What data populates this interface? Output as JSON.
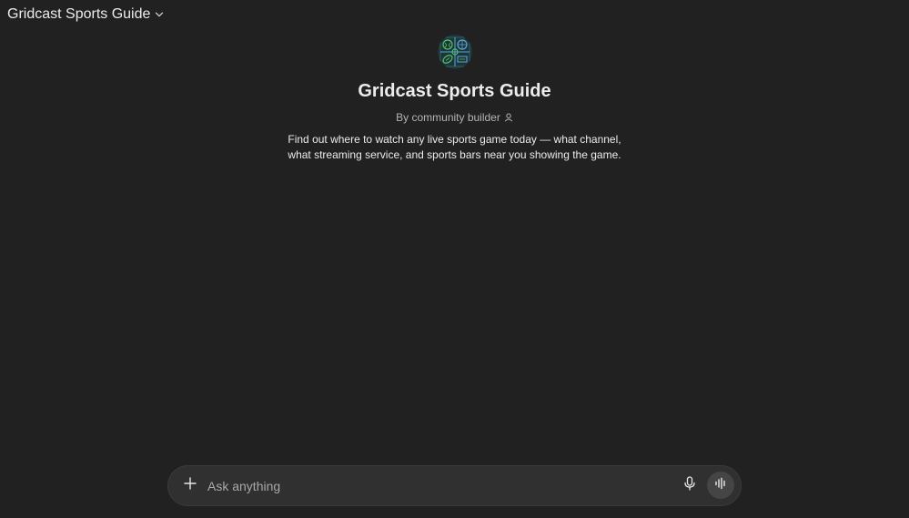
{
  "header": {
    "gpt_selector_label": "Gridcast Sports Guide",
    "chevron_icon": "chevron-down-icon"
  },
  "gpt": {
    "logo_icon": "sports-grid-logo",
    "title": "Gridcast Sports Guide",
    "byline": "By community builder",
    "byline_icon": "person-icon",
    "description": "Find out where to watch any live sports game today — what channel, what streaming service, and sports bars near you showing the game."
  },
  "composer": {
    "placeholder": "Ask anything",
    "value": "",
    "attach_icon": "plus-icon",
    "dictate_icon": "microphone-icon",
    "voice_icon": "voice-waveform-icon"
  },
  "colors": {
    "background": "#212121",
    "composer": "#303030",
    "voice_button": "#454545",
    "logo_bg": "#1f3437",
    "logo_accent_green": "#4fc46a",
    "logo_accent_blue": "#5aa6d6"
  }
}
